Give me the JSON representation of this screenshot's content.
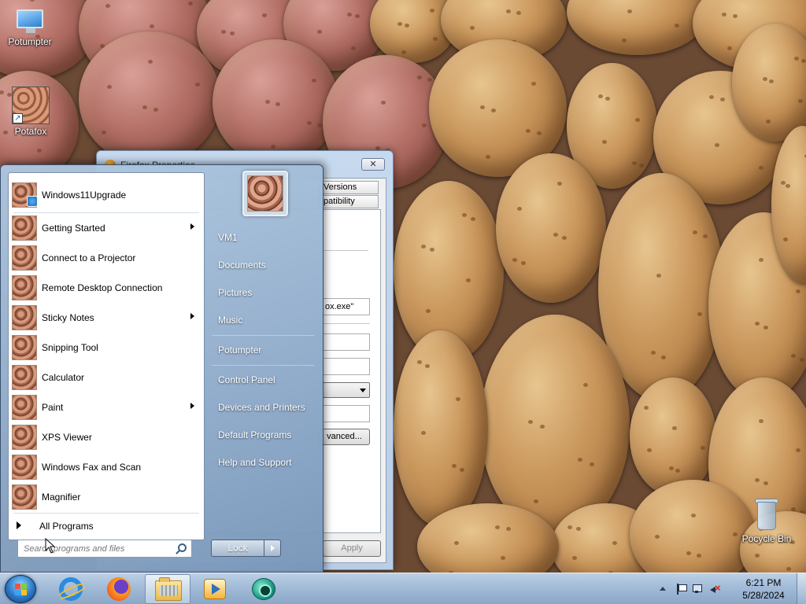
{
  "desktop": {
    "icons": [
      {
        "label": "Potumpter"
      },
      {
        "label": "Potafox"
      },
      {
        "label": "Pocycle Bin"
      }
    ]
  },
  "dialog": {
    "title": "Firefox Properties",
    "close": "✕",
    "tabs": [
      "Versions",
      "patibility"
    ],
    "target_fragment": "ox.exe\"",
    "advanced_button": "vanced...",
    "apply_button": "Apply"
  },
  "start_menu": {
    "programs": [
      {
        "label": "Windows11Upgrade",
        "submenu": false,
        "pinned": true
      },
      {
        "label": "Getting Started",
        "submenu": true
      },
      {
        "label": "Connect to a Projector",
        "submenu": false
      },
      {
        "label": "Remote Desktop Connection",
        "submenu": false
      },
      {
        "label": "Sticky Notes",
        "submenu": true
      },
      {
        "label": "Snipping Tool",
        "submenu": false
      },
      {
        "label": "Calculator",
        "submenu": false
      },
      {
        "label": "Paint",
        "submenu": true
      },
      {
        "label": "XPS Viewer",
        "submenu": false
      },
      {
        "label": "Windows Fax and Scan",
        "submenu": false
      },
      {
        "label": "Magnifier",
        "submenu": false
      }
    ],
    "all_programs": "All Programs",
    "search_placeholder": "Search programs and files",
    "right_items": [
      {
        "label": "VM1"
      },
      {
        "label": "Documents"
      },
      {
        "label": "Pictures"
      },
      {
        "label": "Music"
      },
      {
        "label": "Potumpter"
      },
      {
        "label": "Control Panel"
      },
      {
        "label": "Devices and Printers"
      },
      {
        "label": "Default Programs"
      },
      {
        "label": "Help and Support"
      }
    ],
    "lock_label": "Lock"
  },
  "taskbar": {
    "pinned": [
      {
        "icon": "internet-explorer-icon"
      },
      {
        "icon": "firefox-icon"
      },
      {
        "icon": "windows-explorer-icon",
        "active": true
      },
      {
        "icon": "media-player-icon"
      },
      {
        "icon": "app-bubble-icon"
      }
    ],
    "clock": {
      "time": "6:21 PM",
      "date": "5/28/2024"
    }
  },
  "colors": {
    "taskbar": "#9fb9d6",
    "start_menu_right_pane": "#7896b9",
    "accent": "#2a78c8"
  }
}
